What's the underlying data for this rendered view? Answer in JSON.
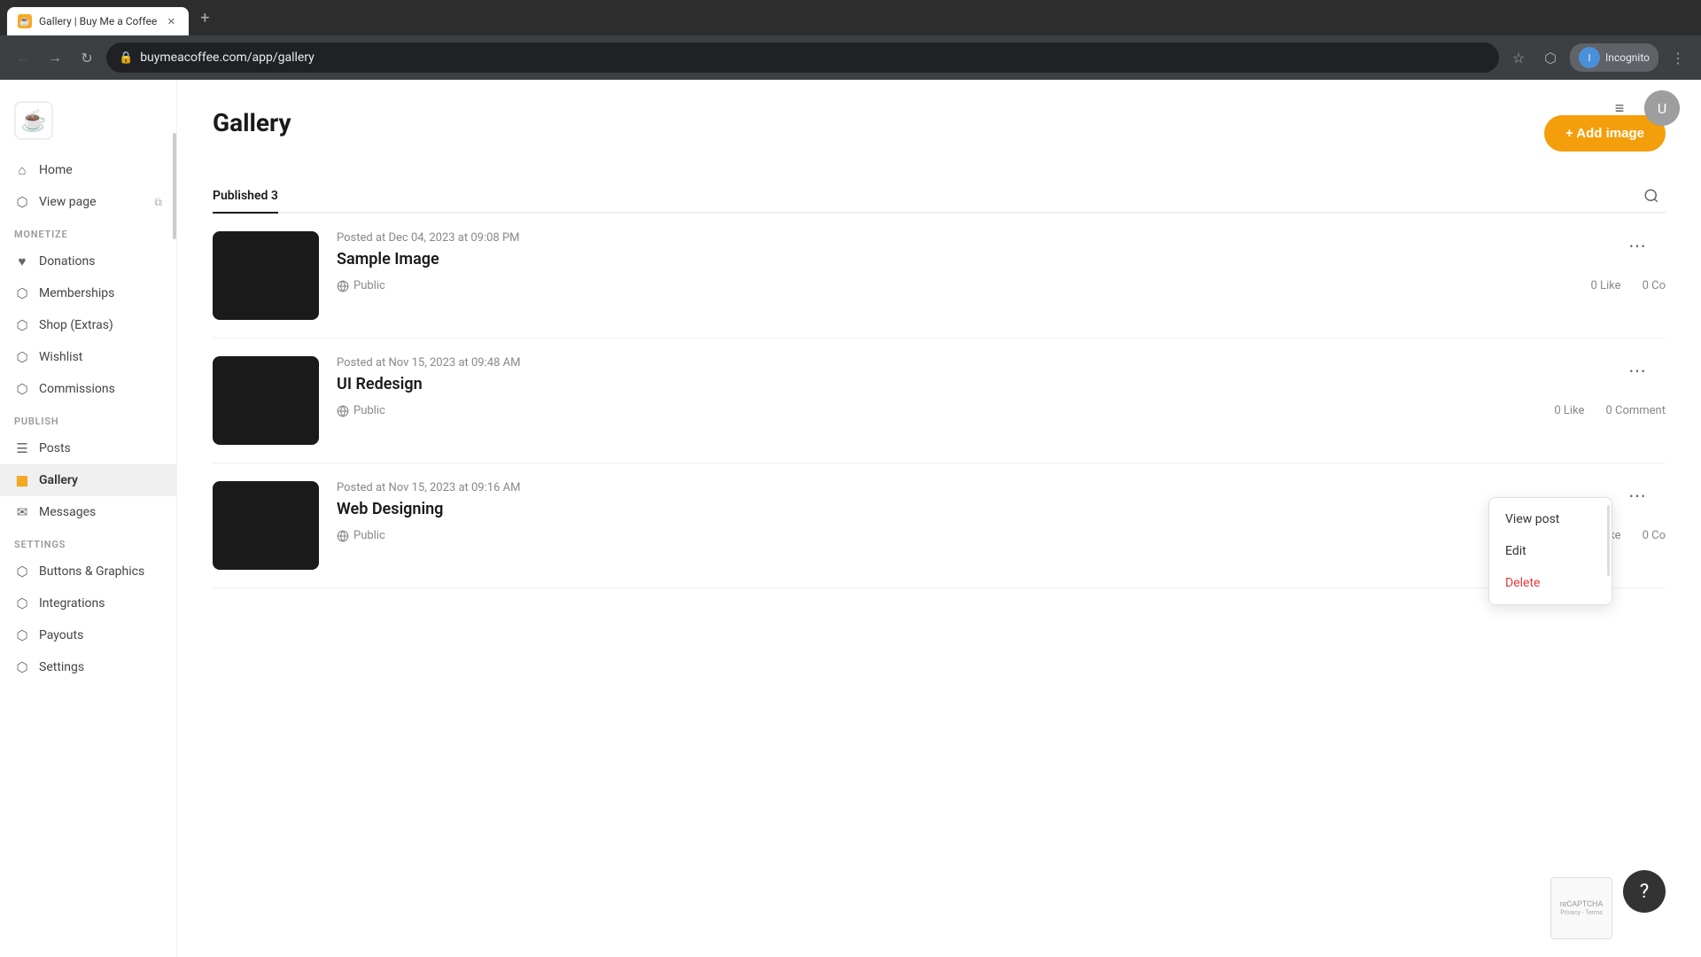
{
  "browser": {
    "tab_title": "Gallery | Buy Me a Coffee",
    "tab_favicon": "☕",
    "address": "buymeacoffee.com/app/gallery",
    "profile_label": "Incognito"
  },
  "header": {
    "hamburger_icon": "≡",
    "avatar_initials": "U"
  },
  "sidebar": {
    "logo": "☕",
    "nav_items": [
      {
        "id": "home",
        "label": "Home",
        "icon": "⌂"
      },
      {
        "id": "view-page",
        "label": "View page",
        "icon": "⬡",
        "has_external": true
      }
    ],
    "sections": [
      {
        "label": "MONETIZE",
        "items": [
          {
            "id": "donations",
            "label": "Donations",
            "icon": "♥"
          },
          {
            "id": "memberships",
            "label": "Memberships",
            "icon": "⬡"
          },
          {
            "id": "shop-extras",
            "label": "Shop (Extras)",
            "icon": "⬡"
          },
          {
            "id": "wishlist",
            "label": "Wishlist",
            "icon": "⬡"
          },
          {
            "id": "commissions",
            "label": "Commissions",
            "icon": "⬡"
          }
        ]
      },
      {
        "label": "PUBLISH",
        "items": [
          {
            "id": "posts",
            "label": "Posts",
            "icon": "☰"
          },
          {
            "id": "gallery",
            "label": "Gallery",
            "icon": "▦",
            "active": true
          },
          {
            "id": "messages",
            "label": "Messages",
            "icon": "✉"
          }
        ]
      },
      {
        "label": "SETTINGS",
        "items": [
          {
            "id": "buttons-graphics",
            "label": "Buttons & Graphics",
            "icon": "⬡"
          },
          {
            "id": "integrations",
            "label": "Integrations",
            "icon": "⬡"
          },
          {
            "id": "payouts",
            "label": "Payouts",
            "icon": "⬡"
          },
          {
            "id": "settings",
            "label": "Settings",
            "icon": "⬡"
          }
        ]
      }
    ]
  },
  "gallery": {
    "page_title": "Gallery",
    "add_button": "+ Add image",
    "tabs": [
      {
        "id": "published",
        "label": "Published 3",
        "active": true
      }
    ],
    "items": [
      {
        "id": "sample-image",
        "date": "Posted at Dec 04, 2023 at 09:08 PM",
        "title": "Sample Image",
        "visibility": "Public",
        "likes": "0 Like",
        "comments": "0 Co",
        "has_menu": true,
        "menu_open": true
      },
      {
        "id": "ui-redesign",
        "date": "Posted at Nov 15, 2023 at 09:48 AM",
        "title": "UI Redesign",
        "visibility": "Public",
        "likes": "0 Like",
        "comments": "0 Comment",
        "has_menu": true,
        "menu_open": false
      },
      {
        "id": "web-designing",
        "date": "Posted at Nov 15, 2023 at 09:16 AM",
        "title": "Web Designing",
        "visibility": "Public",
        "likes": "0 Like",
        "comments": "0 Co",
        "has_menu": true,
        "menu_open": false
      }
    ],
    "context_menu": {
      "items": [
        {
          "id": "view-post",
          "label": "View post"
        },
        {
          "id": "edit",
          "label": "Edit"
        },
        {
          "id": "delete",
          "label": "Delete",
          "destructive": true
        }
      ]
    }
  }
}
